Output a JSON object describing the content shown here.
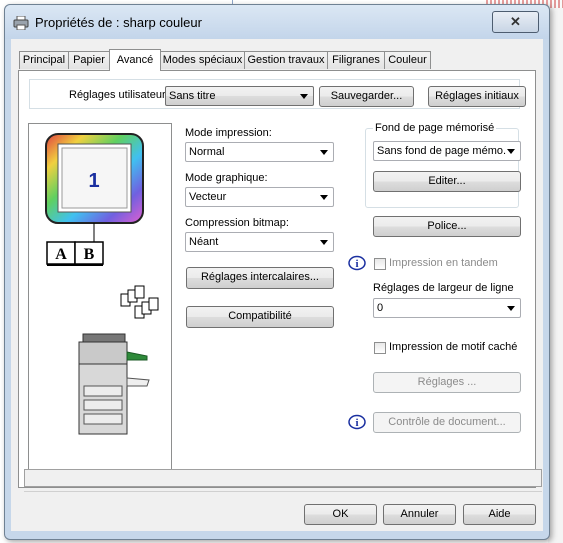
{
  "window": {
    "title": "Propriétés de : sharp couleur",
    "close_symbol": "✕"
  },
  "tabs": [
    "Principal",
    "Papier",
    "Avancé",
    "Modes spéciaux",
    "Gestion travaux",
    "Filigranes",
    "Couleur"
  ],
  "active_tab": "Avancé",
  "user_settings": {
    "label": "Réglages utilisateur:",
    "value": "Sans titre",
    "save_button": "Sauvegarder...",
    "initial_button": "Réglages initiaux"
  },
  "preview": {
    "page_number": "1",
    "letter_a": "A",
    "letter_b": "B"
  },
  "mode_impression": {
    "label": "Mode impression:",
    "value": "Normal"
  },
  "mode_graphique": {
    "label": "Mode graphique:",
    "value": "Vecteur"
  },
  "compression": {
    "label": "Compression bitmap:",
    "value": "Néant"
  },
  "intercalaires_button": "Réglages intercalaires...",
  "compatibilite_button": "Compatibilité",
  "fond_page": {
    "label": "Fond de page mémorisé",
    "value": "Sans fond de page mémo.",
    "edit_button": "Editer..."
  },
  "police_button": "Police...",
  "tandem": {
    "label": "Impression en tandem",
    "checked": false
  },
  "line_width": {
    "label": "Réglages de largeur de ligne",
    "value": "0"
  },
  "hidden_pattern": {
    "label": "Impression de motif caché",
    "checked": false
  },
  "reglages_button": "Réglages ...",
  "document_control_button": "Contrôle de document...",
  "footer": {
    "ok": "OK",
    "cancel": "Annuler",
    "help": "Aide"
  },
  "colors": {
    "titlebar": "#c6d7ea",
    "panel_bg": "#ffffff",
    "client_bg": "#f0f0f0",
    "accent_blue": "#1a2fa0"
  }
}
